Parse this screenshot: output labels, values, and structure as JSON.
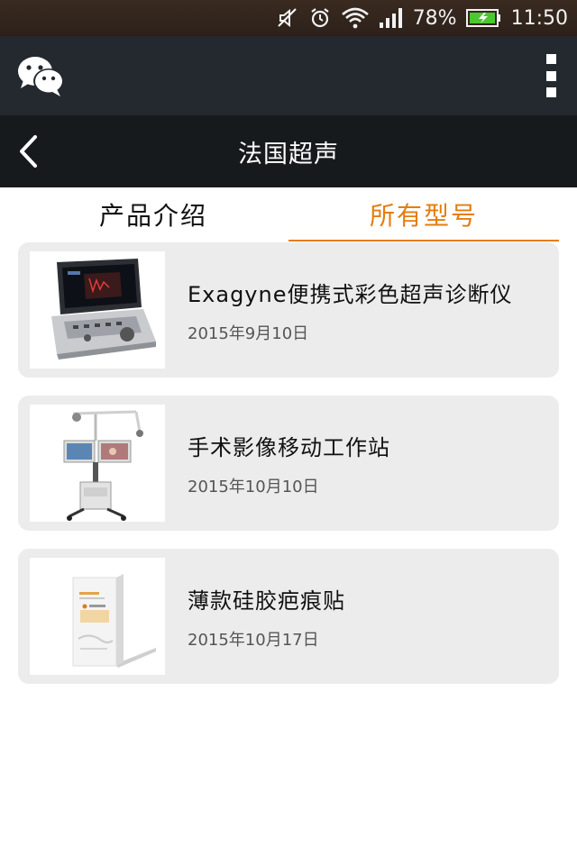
{
  "status_bar": {
    "battery_percent": "78%",
    "time": "11:50",
    "icons": [
      "mute-icon",
      "alarm-icon",
      "wifi-icon",
      "signal-icon",
      "battery-charging-icon"
    ]
  },
  "app_bar": {
    "logo_icon": "wechat-logo-icon",
    "menu_icon": "more-vertical-icon"
  },
  "header": {
    "back_icon": "chevron-left-icon",
    "title": "法国超声"
  },
  "tabs": [
    {
      "label": "产品介绍",
      "active": false
    },
    {
      "label": "所有型号",
      "active": true
    }
  ],
  "colors": {
    "accent": "#e57d0c",
    "card_bg": "#ececec",
    "header_bg": "#171a1c",
    "appbar_bg": "#23292e"
  },
  "products": [
    {
      "title": "Exagyne便携式彩色超声诊断仪",
      "date": "2015年9月10日",
      "image": "laptop-ultrasound-device"
    },
    {
      "title": "手术影像移动工作站",
      "date": "2015年10月10日",
      "image": "mobile-imaging-workstation"
    },
    {
      "title": "薄款硅胶疤痕贴",
      "date": "2015年10月17日",
      "image": "silicone-scar-patch-package"
    }
  ]
}
